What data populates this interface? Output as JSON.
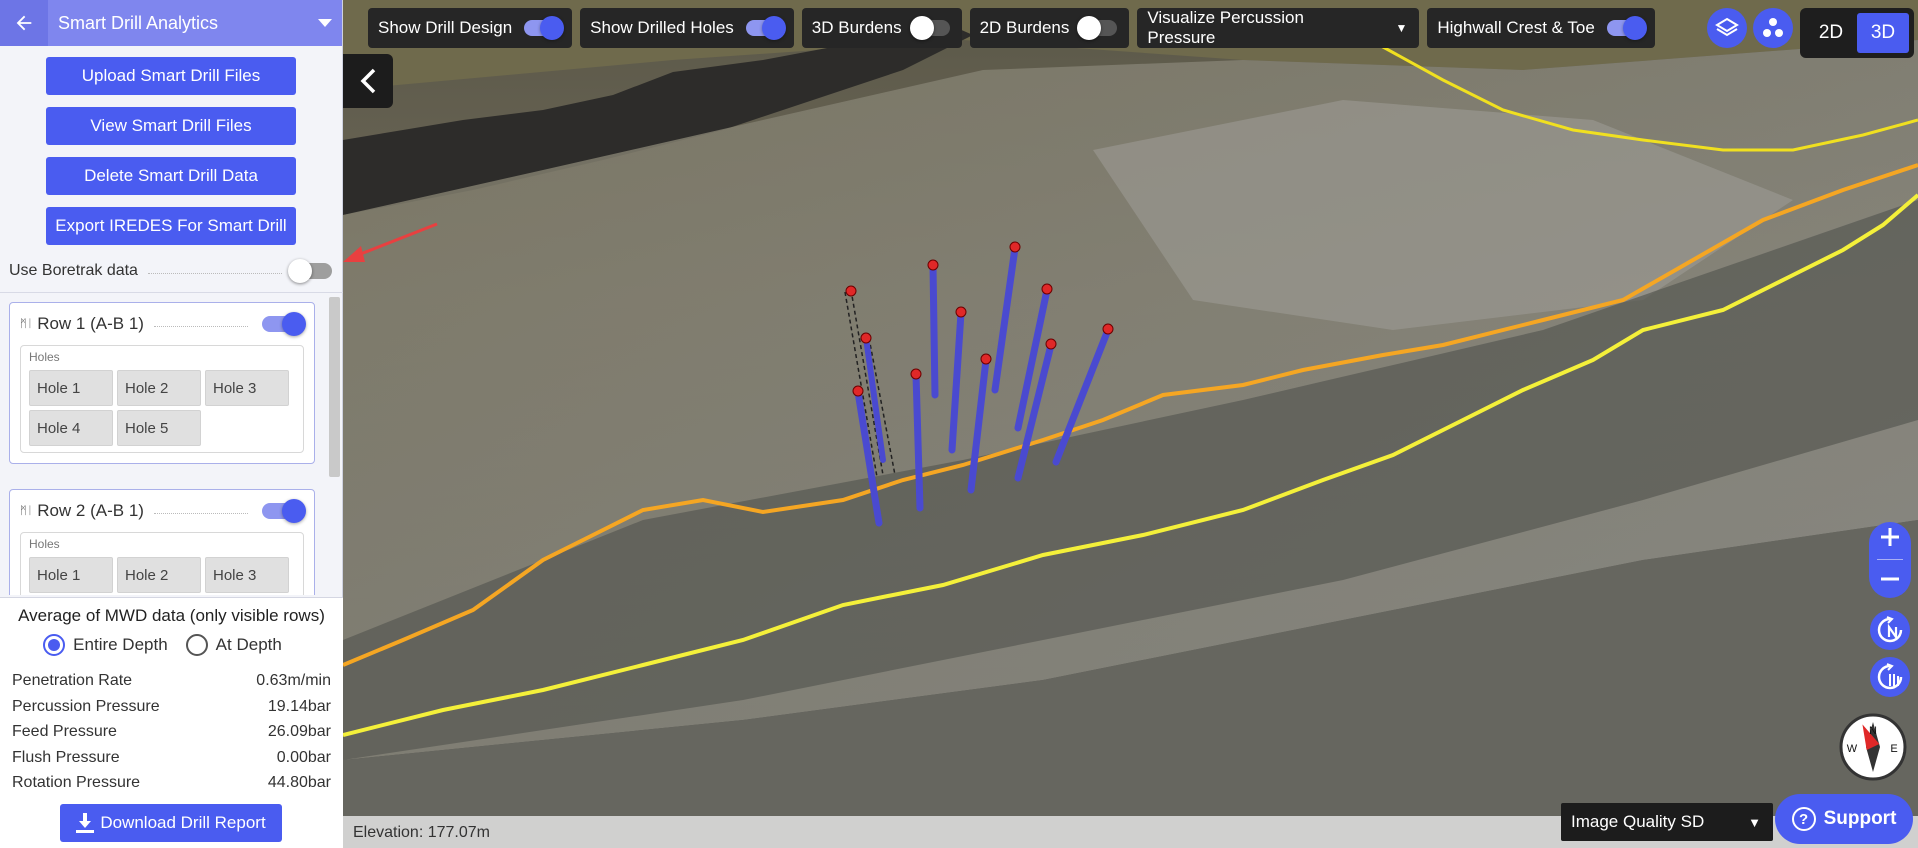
{
  "sidebar": {
    "title": "Smart Drill Analytics",
    "buttons": {
      "upload": "Upload Smart Drill Files",
      "view": "View Smart Drill Files",
      "delete": "Delete Smart Drill Data",
      "export": "Export IREDES For Smart Drill"
    },
    "boretrak_label": "Use Boretrak data",
    "boretrak_enabled": false,
    "rows": [
      {
        "title": "Row 1 (A-B 1)",
        "enabled": true,
        "holes_label": "Holes",
        "holes": [
          "Hole 1",
          "Hole 2",
          "Hole 3",
          "Hole 4",
          "Hole 5"
        ]
      },
      {
        "title": "Row 2 (A-B 1)",
        "enabled": true,
        "holes_label": "Holes",
        "holes": [
          "Hole 1",
          "Hole 2",
          "Hole 3"
        ]
      }
    ],
    "average": {
      "title": "Average of MWD data (only visible rows)",
      "radio_entire": "Entire Depth",
      "radio_at": "At Depth",
      "selected": "Entire Depth",
      "stats": [
        {
          "label": "Penetration Rate",
          "value": "0.63m/min"
        },
        {
          "label": "Percussion Pressure",
          "value": "19.14bar"
        },
        {
          "label": "Feed Pressure",
          "value": "26.09bar"
        },
        {
          "label": "Flush Pressure",
          "value": "0.00bar"
        },
        {
          "label": "Rotation Pressure",
          "value": "44.80bar"
        }
      ],
      "download_label": "Download Drill Report"
    }
  },
  "toolbar": {
    "show_drill_design": "Show Drill Design",
    "show_drilled_holes": "Show Drilled Holes",
    "burdens_3d": "3D Burdens",
    "burdens_2d": "2D Burdens",
    "visualize": "Visualize Percussion Pressure",
    "highwall": "Highwall Crest & Toe",
    "states": {
      "show_drill_design": true,
      "show_drilled_holes": true,
      "burdens_3d": false,
      "burdens_2d": false,
      "highwall": true
    }
  },
  "view_mode": {
    "option_2d": "2D",
    "option_3d": "3D",
    "active": "3D"
  },
  "footer": {
    "elevation": "Elevation: 177.07m",
    "image_quality": "Image Quality SD",
    "support": "Support"
  },
  "colors": {
    "accent": "#4a5cf0",
    "header": "#7f86ee",
    "crest_line": "#f5a623",
    "toe_line": "#f4f03a",
    "drill_hole": "#4a4ad0",
    "hole_collar": "#e02828",
    "annotation_arrow": "#e84040"
  },
  "icons": {
    "back": "arrow-left-icon",
    "caret": "caret-down-icon",
    "collapse": "chevron-left-icon",
    "layers": "layers-icon",
    "points": "scatter-icon",
    "zoom_in": "plus-icon",
    "zoom_out": "minus-icon",
    "rotate_north": "rotate-north-icon",
    "tilt": "tilt-icon",
    "compass": "compass-icon",
    "download": "download-icon",
    "support": "question-icon"
  }
}
